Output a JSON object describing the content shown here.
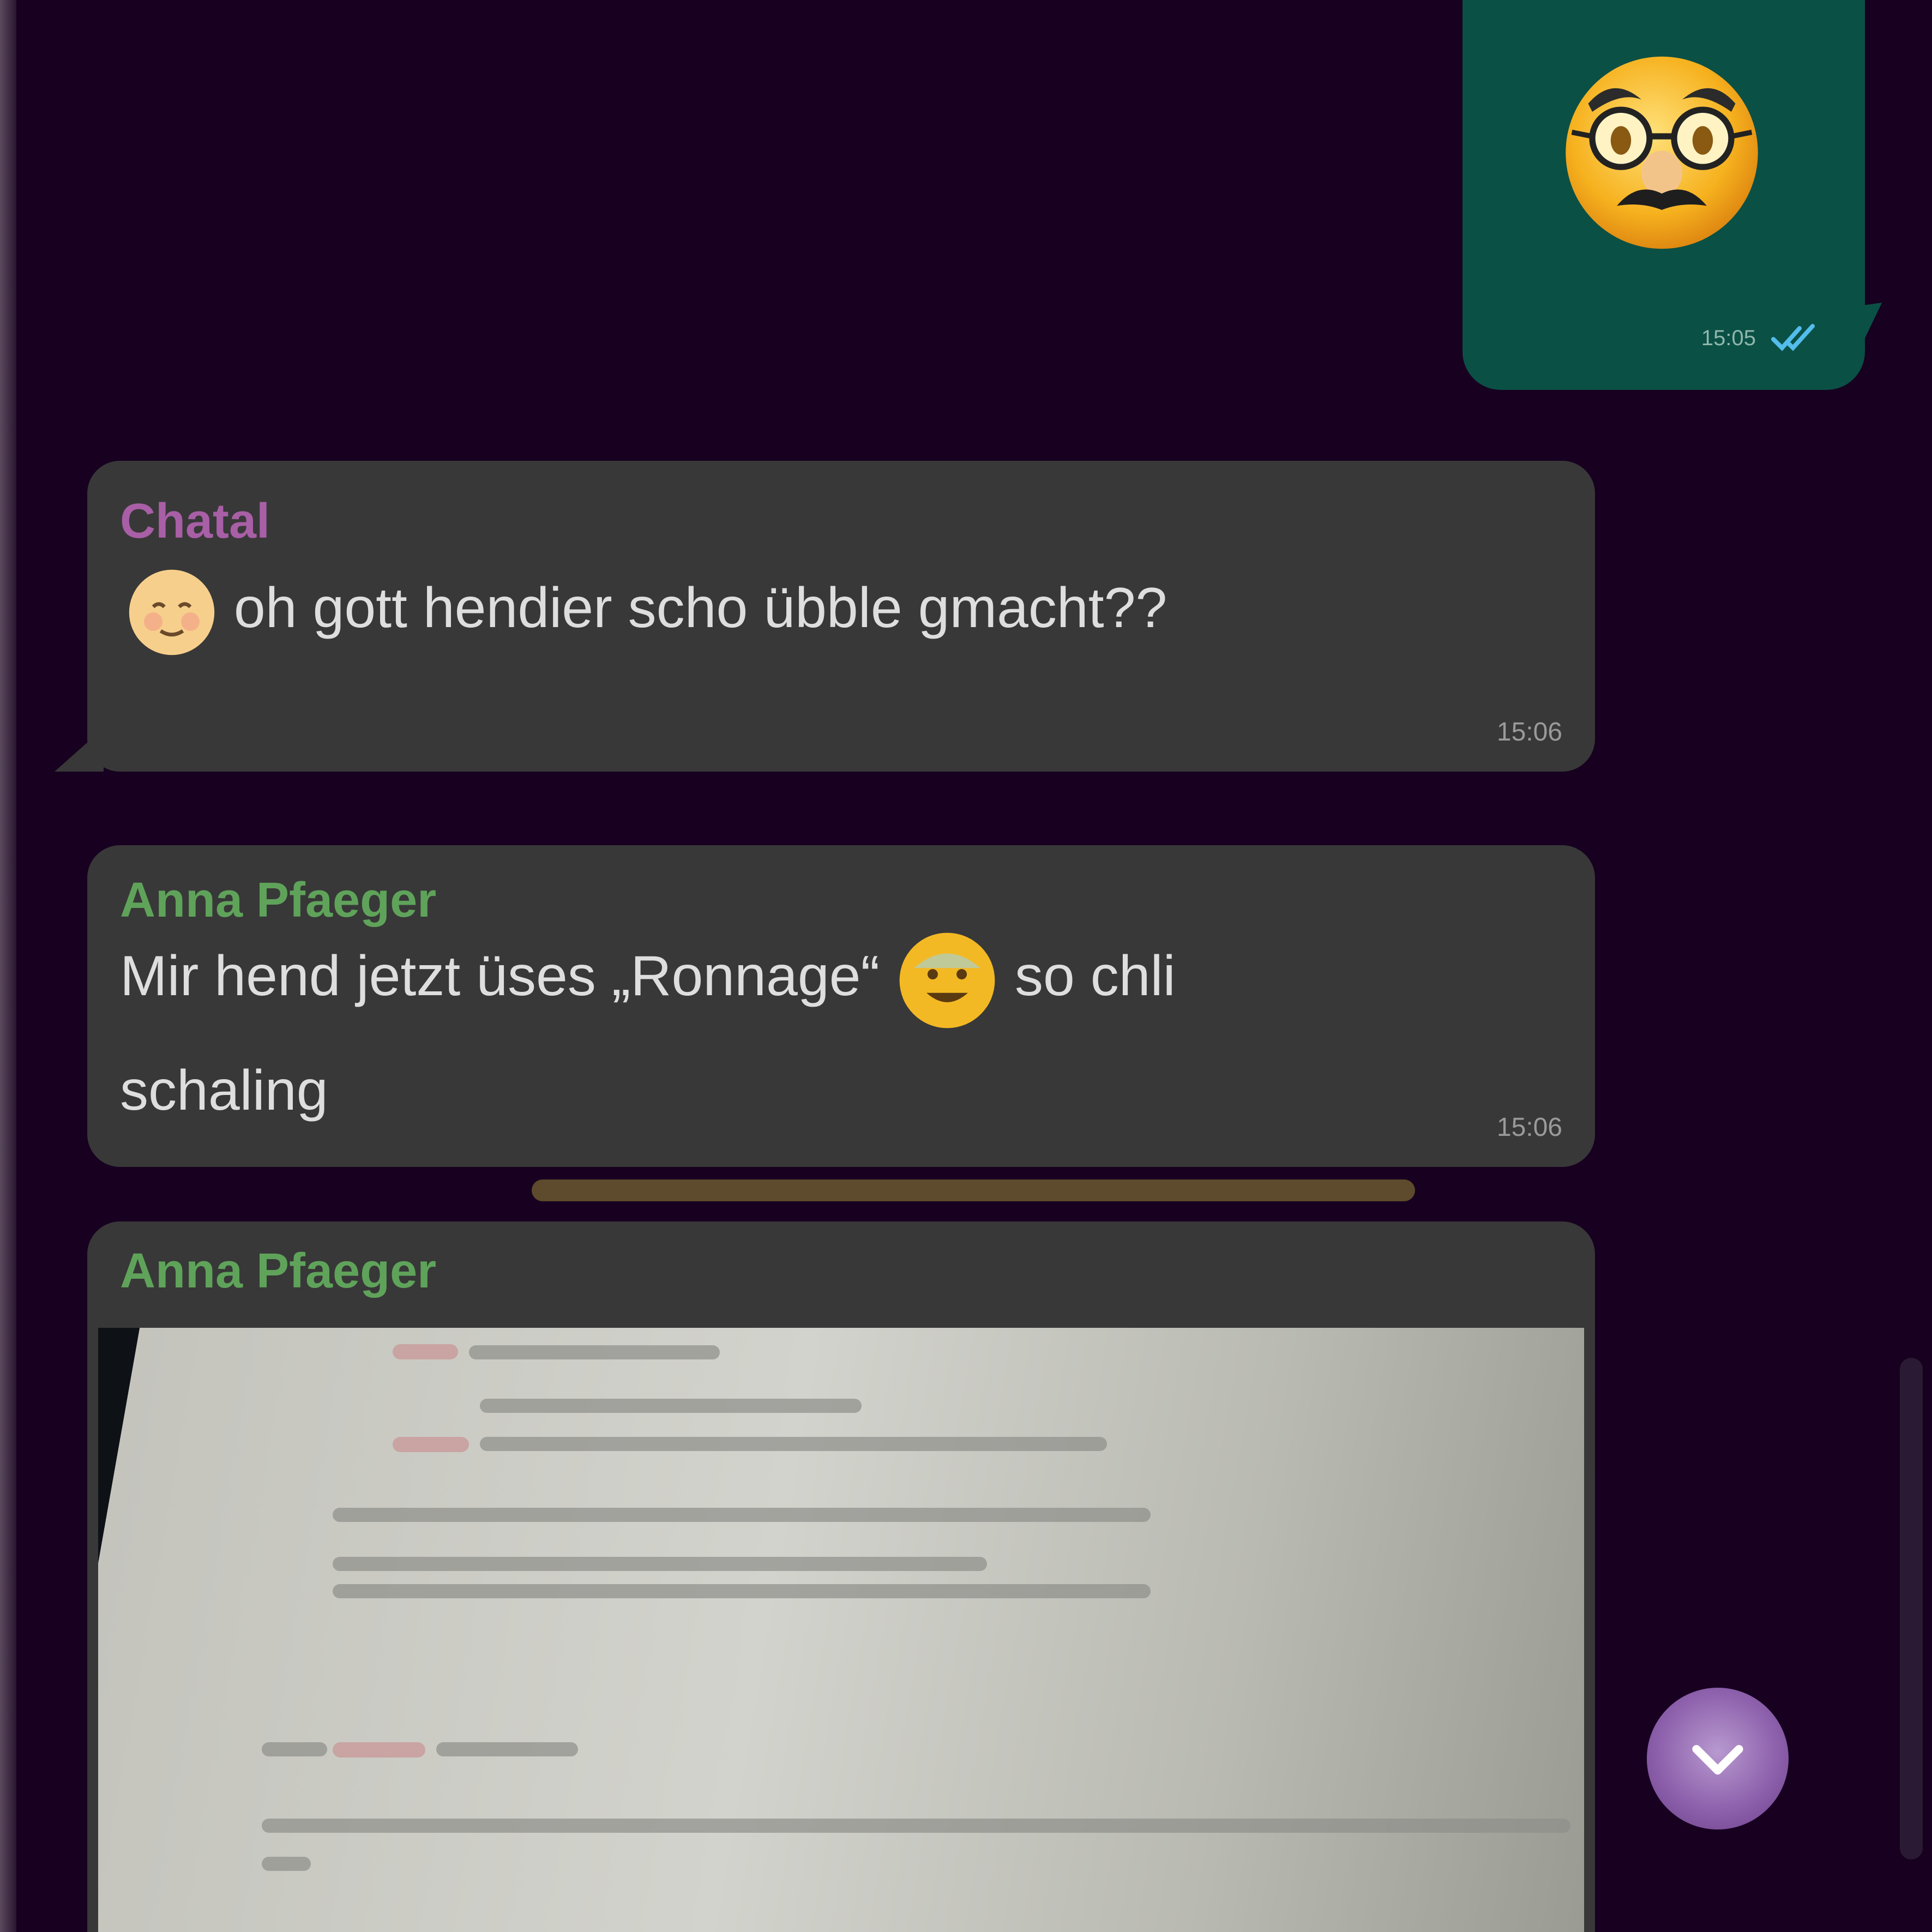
{
  "chat": {
    "outgoing_sticker": {
      "sticker": "disguised-face-emoji",
      "time": "15:05",
      "status": "read",
      "read_color": "#53bdeb"
    },
    "messages": [
      {
        "sender": "Chatal",
        "sender_color": "#a85fa6",
        "emoji": "blushing-face-emoji",
        "text": "oh gott hendier scho übble gmacht??",
        "time": "15:06"
      },
      {
        "sender": "Anna Pfaeger",
        "sender_color": "#5fa35a",
        "text_line1": "Mir hend jetzt üses „Ronnage“",
        "emoji": "grinning-face-emoji",
        "text_line1_end": "so chli",
        "text_line2": "schaling",
        "time": "15:06"
      },
      {
        "sender": "Anna Pfaeger",
        "sender_color": "#5fa35a",
        "attachment": "photo"
      }
    ],
    "scroll_button": "scroll-down-icon"
  },
  "colors": {
    "background": "#170020",
    "outgoing_bubble": "#0b5045",
    "incoming_bubble": "#383838",
    "accent": "#8e62ad"
  }
}
